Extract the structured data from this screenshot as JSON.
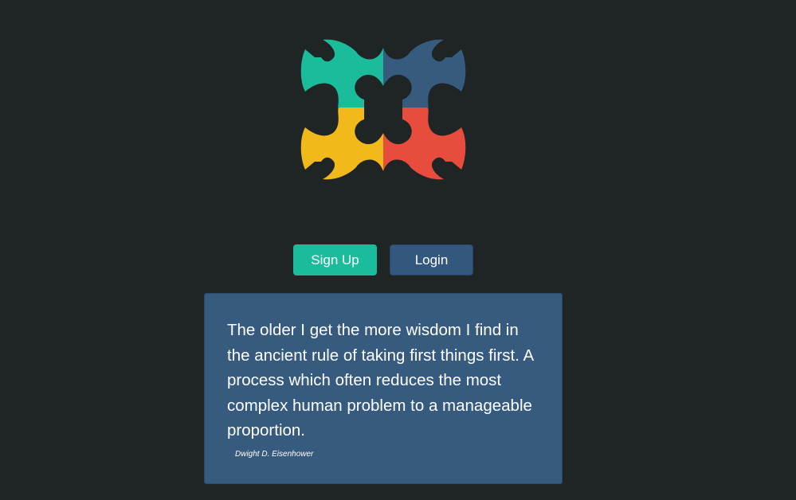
{
  "logo": {
    "icon": "quatrefoil-logo-icon",
    "colors": {
      "teal": "#1abc9c",
      "blue": "#375a7f",
      "yellow": "#f1b91a",
      "red": "#e74c3c"
    }
  },
  "actions": {
    "signup_label": "Sign Up",
    "login_label": "Login"
  },
  "quote": {
    "text": "The older I get the more wisdom I find in the ancient rule of taking first things first. A process which often reduces the most complex human problem to a manageable proportion.",
    "author": "Dwight D. Eisenhower"
  },
  "theme": {
    "background": "#1f2424",
    "accent": "#1abc9c",
    "card": "#375a7f"
  }
}
